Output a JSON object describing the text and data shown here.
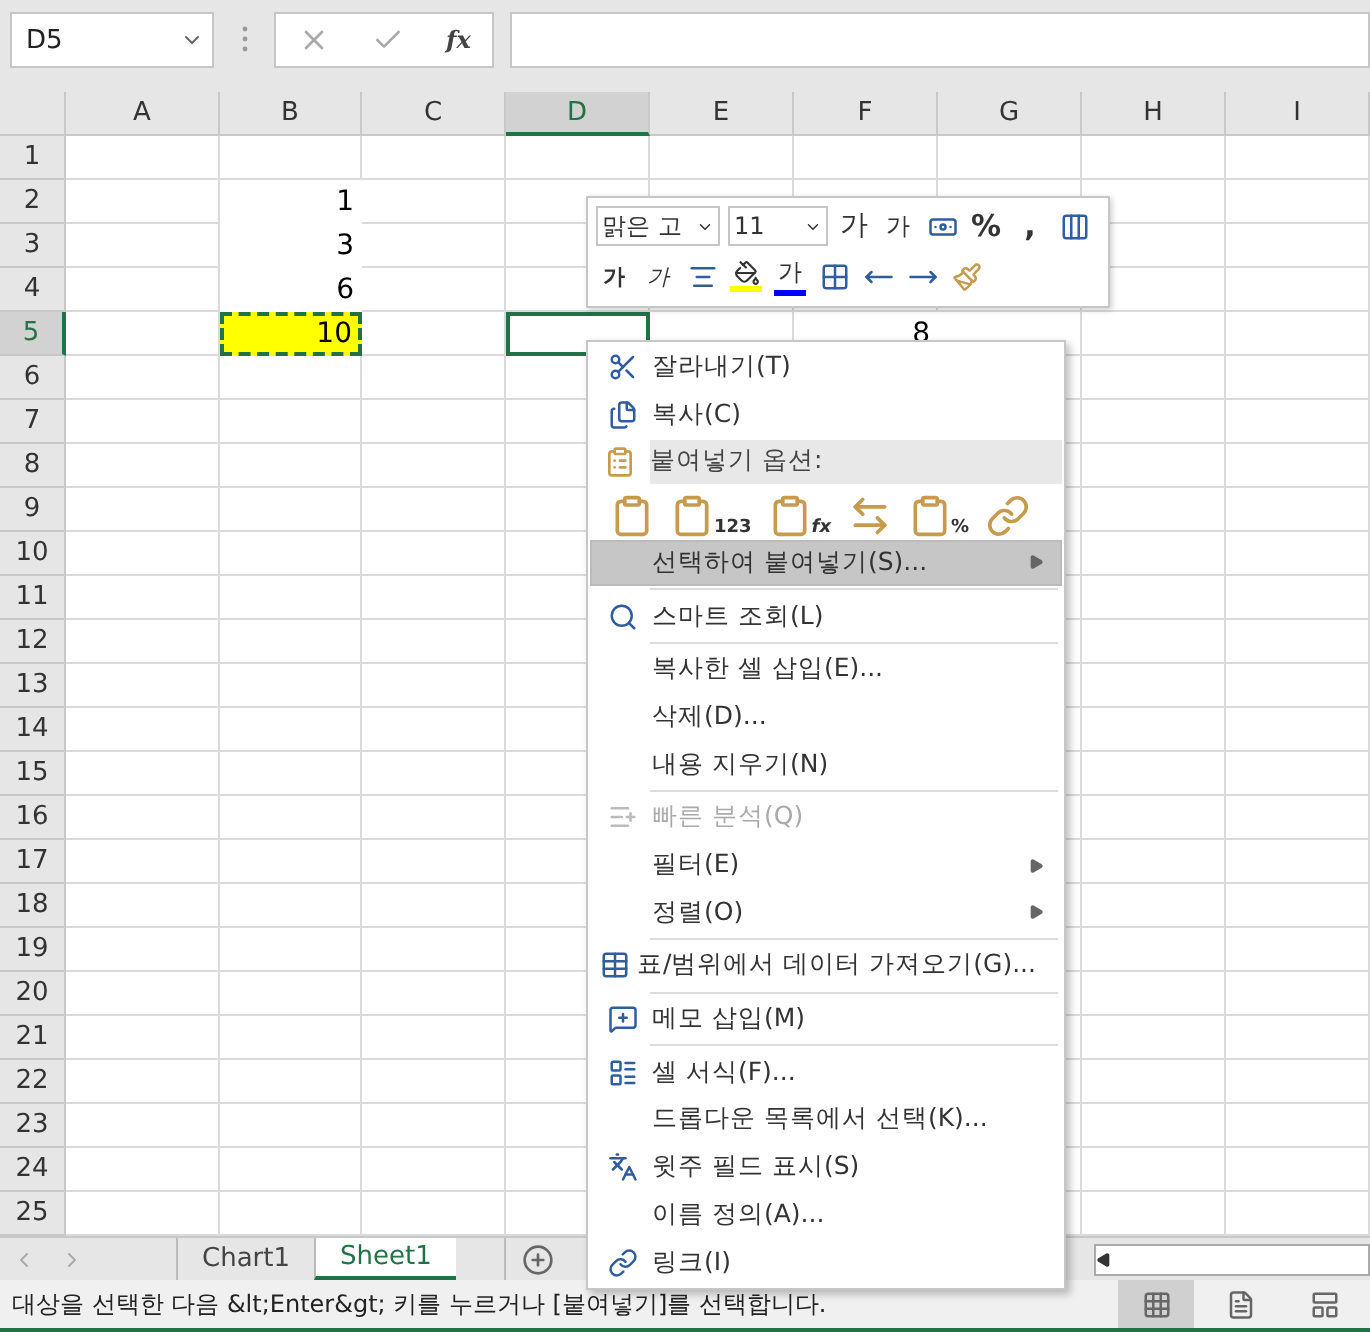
{
  "formula_bar": {
    "name_box": "D5",
    "function_label": "fx"
  },
  "grid": {
    "columns": [
      {
        "label": "A",
        "selected": false
      },
      {
        "label": "B",
        "selected": false
      },
      {
        "label": "C",
        "selected": false
      },
      {
        "label": "D",
        "selected": true
      },
      {
        "label": "E",
        "selected": false
      },
      {
        "label": "F",
        "selected": false
      },
      {
        "label": "G",
        "selected": false
      },
      {
        "label": "H",
        "selected": false
      },
      {
        "label": "I",
        "selected": false
      }
    ],
    "rows": [
      {
        "label": "1",
        "selected": false,
        "cells": []
      },
      {
        "label": "2",
        "selected": false,
        "cells": {
          "B": {
            "value": "1"
          }
        }
      },
      {
        "label": "3",
        "selected": false,
        "cells": {
          "B": {
            "value": "3"
          }
        }
      },
      {
        "label": "4",
        "selected": false,
        "cells": {
          "B": {
            "value": "6"
          }
        }
      },
      {
        "label": "5",
        "selected": true,
        "cells": {
          "B": {
            "value": "10",
            "color": "#ffff00",
            "copied": true
          },
          "D": {
            "active": true
          },
          "F": {
            "value": "8"
          }
        }
      },
      {
        "label": "6",
        "selected": false,
        "cells": []
      },
      {
        "label": "7",
        "selected": false,
        "cells": []
      },
      {
        "label": "8",
        "selected": false,
        "cells": []
      },
      {
        "label": "9",
        "selected": false,
        "cells": []
      },
      {
        "label": "10",
        "selected": false,
        "cells": []
      },
      {
        "label": "11",
        "selected": false,
        "cells": []
      },
      {
        "label": "12",
        "selected": false,
        "cells": []
      },
      {
        "label": "13",
        "selected": false,
        "cells": []
      },
      {
        "label": "14",
        "selected": false,
        "cells": []
      },
      {
        "label": "15",
        "selected": false,
        "cells": []
      },
      {
        "label": "16",
        "selected": false,
        "cells": []
      },
      {
        "label": "17",
        "selected": false,
        "cells": []
      },
      {
        "label": "18",
        "selected": false,
        "cells": []
      },
      {
        "label": "19",
        "selected": false,
        "cells": []
      },
      {
        "label": "20",
        "selected": false,
        "cells": []
      },
      {
        "label": "21",
        "selected": false,
        "cells": []
      },
      {
        "label": "22",
        "selected": false,
        "cells": []
      },
      {
        "label": "23",
        "selected": false,
        "cells": []
      },
      {
        "label": "24",
        "selected": false,
        "cells": []
      },
      {
        "label": "25",
        "selected": false,
        "cells": []
      }
    ]
  },
  "mini_toolbar": {
    "font_name": "맑은 고",
    "font_size": "11",
    "row_1": [
      {
        "kind": "grow",
        "label": "가"
      },
      {
        "kind": "shrink",
        "label": "가"
      },
      {
        "kind": "currency"
      },
      {
        "kind": "percent",
        "label": "%"
      },
      {
        "kind": "comma",
        "label": ","
      },
      {
        "kind": "tableformat"
      }
    ],
    "row_2": [
      {
        "kind": "bold",
        "label": "가"
      },
      {
        "kind": "italic",
        "label": "가"
      },
      {
        "kind": "align"
      },
      {
        "kind": "fill",
        "color": "#ffff00"
      },
      {
        "kind": "fontcolor",
        "label": "가",
        "color": "#0000ff"
      },
      {
        "kind": "borders"
      },
      {
        "kind": "incdecimal"
      },
      {
        "kind": "decdecimal"
      },
      {
        "kind": "painter"
      }
    ]
  },
  "context_menu": [
    {
      "kind": "cut",
      "label": "잘라내기(T)",
      "selected": false,
      "disabled": false,
      "submenu": false
    },
    {
      "kind": "copy",
      "label": "복사(C)",
      "selected": false,
      "disabled": false,
      "submenu": false
    },
    {
      "kind": "header",
      "label": "붙여넣기 옵션:"
    },
    {
      "kind": "paste",
      "options": [
        {
          "kind": "plain"
        },
        {
          "kind": "values",
          "label": "123"
        },
        {
          "kind": "formula",
          "label": "fx"
        },
        {
          "kind": "transpose"
        },
        {
          "kind": "formatting",
          "label": "%"
        },
        {
          "kind": "link"
        }
      ]
    },
    {
      "kind": "plain",
      "label": "선택하여 붙여넣기(S)...",
      "selected": true,
      "disabled": false,
      "submenu": true
    },
    {
      "kind": "separator"
    },
    {
      "kind": "lookup",
      "label": "스마트 조회(L)",
      "selected": false,
      "disabled": false,
      "submenu": false
    },
    {
      "kind": "separator"
    },
    {
      "kind": "plain",
      "label": "복사한 셀 삽입(E)...",
      "selected": false,
      "disabled": false,
      "submenu": false
    },
    {
      "kind": "plain",
      "label": "삭제(D)...",
      "selected": false,
      "disabled": false,
      "submenu": false
    },
    {
      "kind": "plain",
      "label": "내용 지우기(N)",
      "selected": false,
      "disabled": false,
      "submenu": false
    },
    {
      "kind": "separator"
    },
    {
      "kind": "analysis",
      "label": "빠른 분석(Q)",
      "selected": false,
      "disabled": true,
      "submenu": false
    },
    {
      "kind": "plain",
      "label": "필터(E)",
      "selected": false,
      "disabled": false,
      "submenu": true
    },
    {
      "kind": "plain",
      "label": "정렬(O)",
      "selected": false,
      "disabled": false,
      "submenu": true
    },
    {
      "kind": "separator"
    },
    {
      "kind": "table",
      "label": "표/범위에서 데이터 가져오기(G)...",
      "selected": false,
      "disabled": false,
      "submenu": false
    },
    {
      "kind": "separator"
    },
    {
      "kind": "comment",
      "label": "메모 삽입(M)",
      "selected": false,
      "disabled": false,
      "submenu": false
    },
    {
      "kind": "separator"
    },
    {
      "kind": "format",
      "label": "셀 서식(F)...",
      "selected": false,
      "disabled": false,
      "submenu": false
    },
    {
      "kind": "plain",
      "label": "드롭다운 목록에서 선택(K)...",
      "selected": false,
      "disabled": false,
      "submenu": false
    },
    {
      "kind": "phonetic",
      "label": "윗주 필드 표시(S)",
      "selected": false,
      "disabled": false,
      "submenu": false
    },
    {
      "kind": "plain",
      "label": "이름 정의(A)...",
      "selected": false,
      "disabled": false,
      "submenu": false
    },
    {
      "kind": "link",
      "label": "링크(I)",
      "selected": false,
      "disabled": false,
      "submenu": false
    }
  ],
  "sheet_tabs": [
    {
      "label": "Chart1",
      "selected": false
    },
    {
      "label": "Sheet1",
      "selected": true
    }
  ],
  "status_bar": {
    "message": "대상을 선택한 다음 &lt;Enter&gt; 키를 누르거나 [붙여넣기]를 선택합니다.",
    "views": [
      {
        "kind": "normal",
        "selected": true
      },
      {
        "kind": "pagelayout",
        "selected": false
      },
      {
        "kind": "pagebreak",
        "selected": false
      }
    ]
  }
}
